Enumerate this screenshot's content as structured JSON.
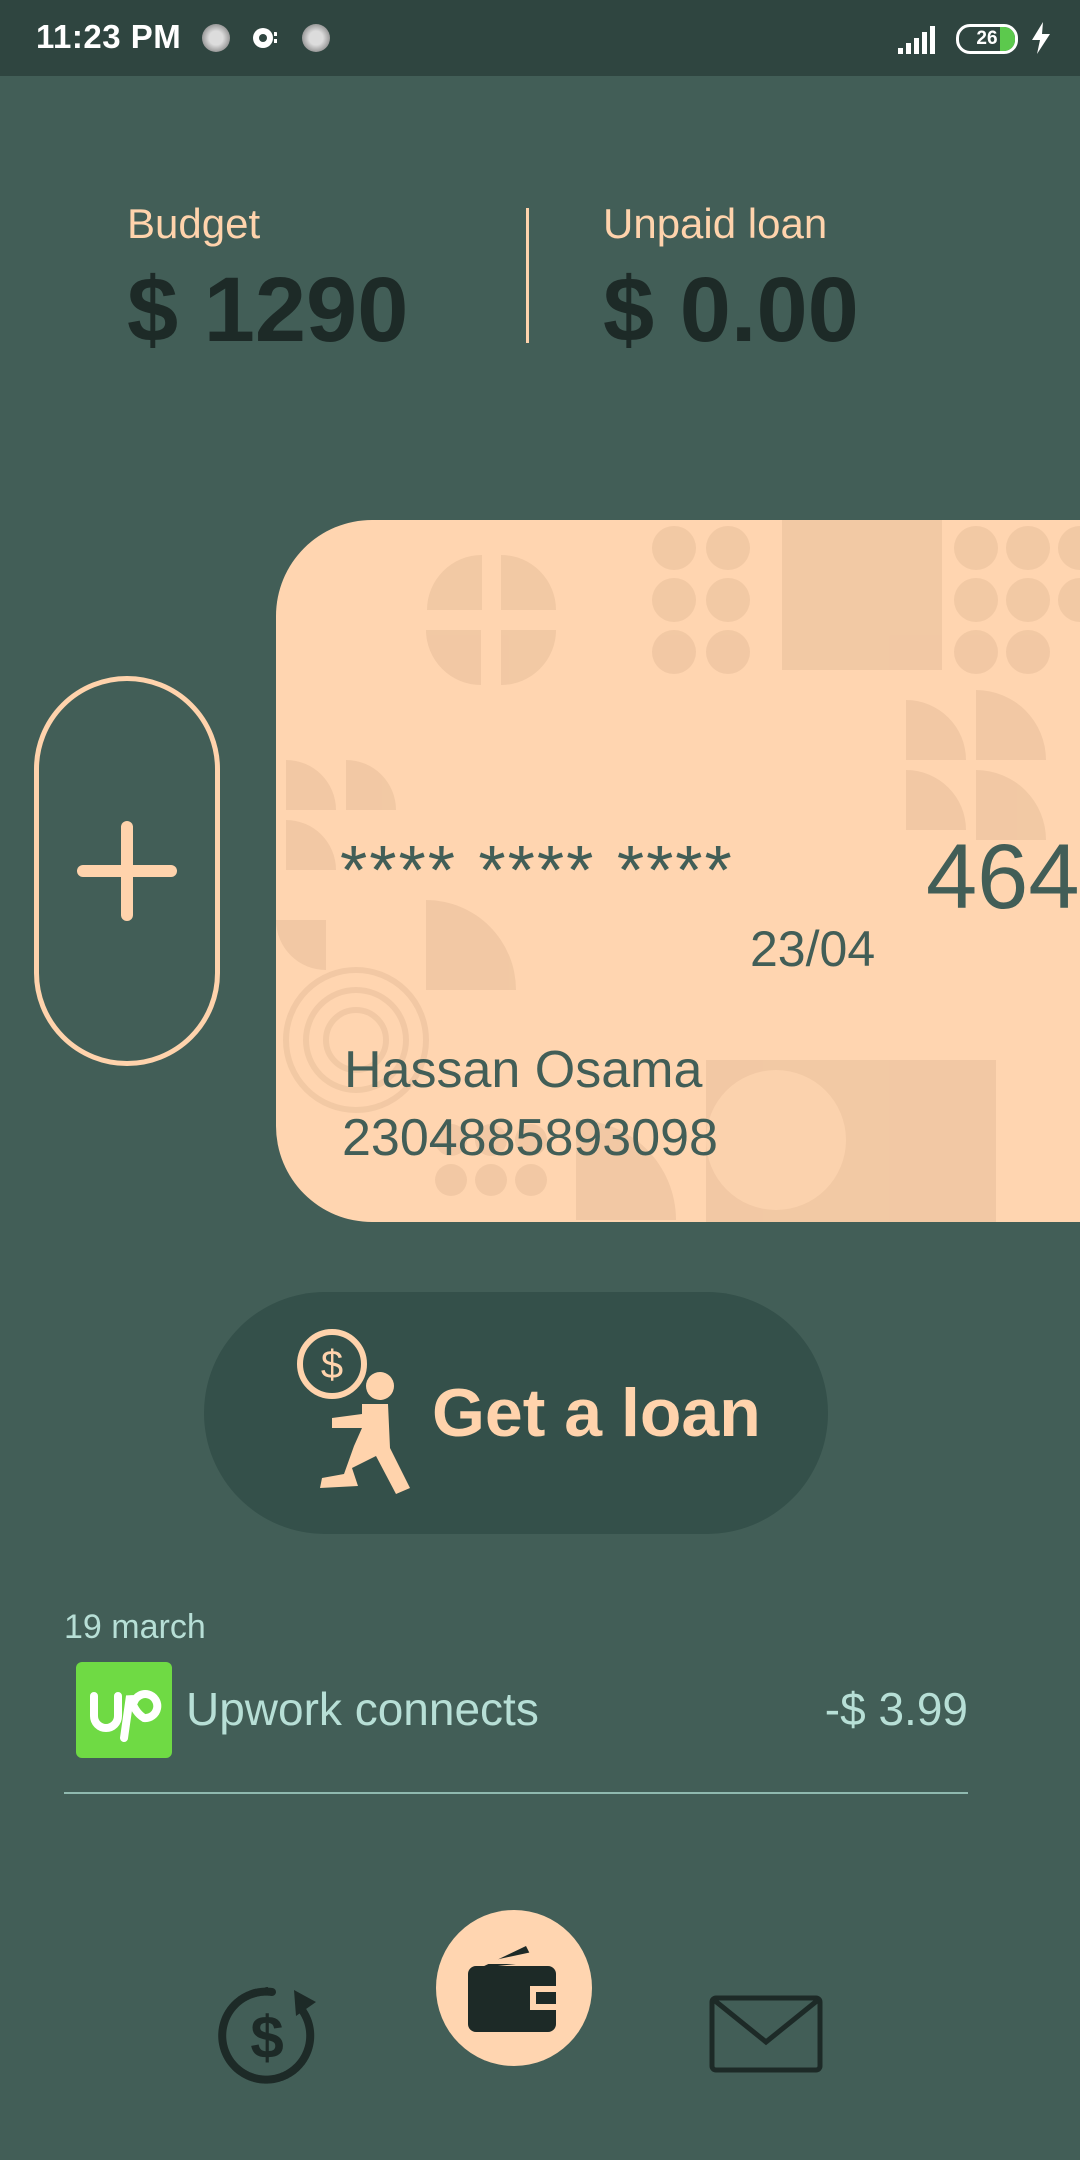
{
  "status_bar": {
    "time": "11:23 PM",
    "battery_level": "26",
    "battery_fraction": 0.26,
    "icons": [
      "notification-dot-icon",
      "podcast-icon",
      "notification-dot-icon",
      "signal-icon",
      "battery-icon",
      "charging-bolt-icon"
    ]
  },
  "summary": {
    "budget_label": "Budget",
    "budget_value": "$ 1290",
    "loan_label": "Unpaid loan",
    "loan_value": "$ 0.00"
  },
  "card": {
    "masked_number": "**** **** ****",
    "last_digits": "464",
    "expiry": "23/04",
    "holder_name": "Hassan Osama",
    "account_number": "2304885893098"
  },
  "actions": {
    "add_card_icon": "plus-icon",
    "loan_label": "Get a loan",
    "loan_icon": "person-carrying-coin-icon"
  },
  "transactions": [
    {
      "date": "19 march",
      "name": "Upwork connects",
      "amount": "-$ 3.99",
      "logo": "upwork-logo",
      "logo_text": "Up"
    }
  ],
  "bottom_nav": [
    {
      "name": "history",
      "icon": "dollar-history-icon"
    },
    {
      "name": "wallet",
      "icon": "wallet-icon",
      "active": true
    },
    {
      "name": "messages",
      "icon": "envelope-icon"
    }
  ],
  "colors": {
    "background": "#425e57",
    "status_bar": "#2f4540",
    "accent": "#ffd3ac",
    "card": "#ffd5b0",
    "dark_text": "#1d2a27",
    "muted_text": "#b7dfd6",
    "button_bg": "#34504a",
    "upwork_green": "#6fda44"
  }
}
